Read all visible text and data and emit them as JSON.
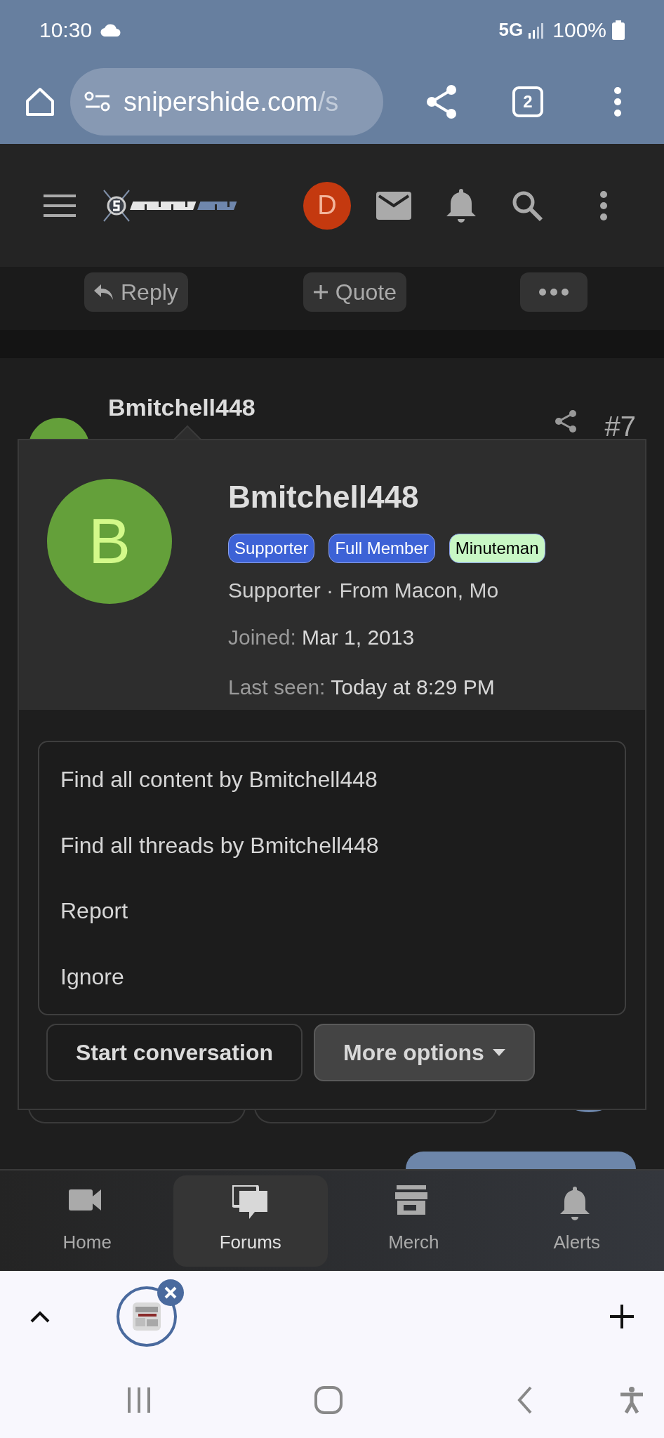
{
  "status_bar": {
    "time": "10:30",
    "network": "5G",
    "battery": "100%"
  },
  "browser": {
    "url_host": "snipershide.com",
    "url_rest": "/s",
    "tab_count": "2"
  },
  "site_header": {
    "avatar_letter": "D"
  },
  "post_actions": [
    {
      "kind": "reply",
      "label": "Reply"
    },
    {
      "kind": "quote",
      "label": "Quote"
    },
    {
      "kind": "more"
    }
  ],
  "post": {
    "username": "Bmitchell448",
    "number": "#7"
  },
  "popup": {
    "avatar_letter": "B",
    "username": "Bmitchell448",
    "badges": [
      {
        "label": "Supporter",
        "color": "#3d62d6"
      },
      {
        "label": "Full Member",
        "color": "#3d62d6"
      },
      {
        "label": "Minuteman",
        "color": "#c8f7c5"
      }
    ],
    "subtitle": "Supporter · From Macon, Mo",
    "joined_label": "Joined:",
    "joined": "Mar 1, 2013",
    "last_seen_label": "Last seen:",
    "last_seen": "Today at 8:29 PM",
    "menu": [
      "Find all content by Bmitchell448",
      "Find all threads by Bmitchell448",
      "Report",
      "Ignore"
    ],
    "buttons": [
      {
        "kind": "outline",
        "label": "Start conversation"
      },
      {
        "kind": "dropdown",
        "label": "More options"
      }
    ]
  },
  "bottom_nav": [
    {
      "kind": "video",
      "label": "Home",
      "selected": false
    },
    {
      "kind": "forums",
      "label": "Forums",
      "selected": true
    },
    {
      "kind": "store",
      "label": "Merch",
      "selected": false
    },
    {
      "kind": "bell",
      "label": "Alerts",
      "selected": false
    }
  ]
}
